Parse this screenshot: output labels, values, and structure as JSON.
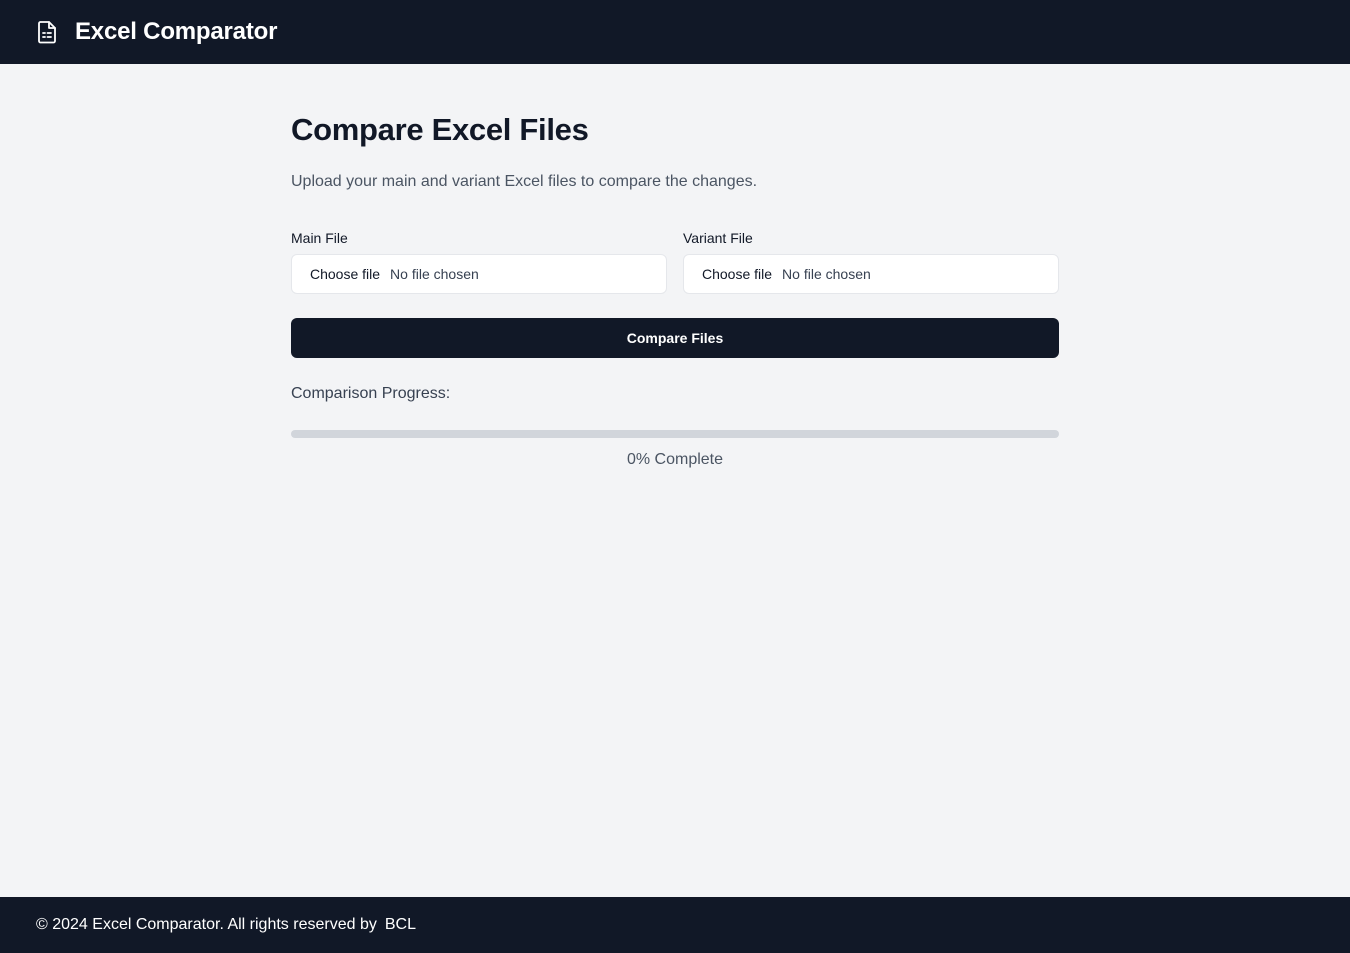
{
  "header": {
    "app_title": "Excel Comparator",
    "logo_icon": "file-spreadsheet-icon"
  },
  "main": {
    "title": "Compare Excel Files",
    "subtitle": "Upload your main and variant Excel files to compare the changes.",
    "main_file": {
      "label": "Main File",
      "button_label": "Choose file",
      "status": "No file chosen"
    },
    "variant_file": {
      "label": "Variant File",
      "button_label": "Choose file",
      "status": "No file chosen"
    },
    "compare_button": "Compare Files",
    "progress": {
      "label": "Comparison Progress:",
      "value": 0,
      "text": "0% Complete"
    }
  },
  "footer": {
    "text": "© 2024 Excel Comparator. All rights reserved by",
    "brand": "BCL"
  },
  "colors": {
    "header_bg": "#111827",
    "page_bg": "#f3f4f6",
    "button_bg": "#111827",
    "progress_track": "#d1d5db"
  }
}
